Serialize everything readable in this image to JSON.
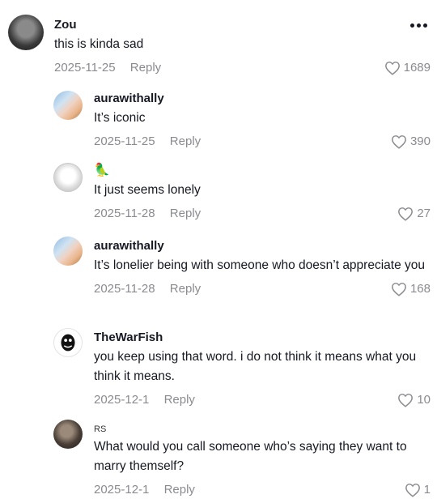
{
  "comments": [
    {
      "username": "Zou",
      "text": "this is kinda sad",
      "date": "2025-11-25",
      "reply": "Reply",
      "likes": "1689"
    },
    {
      "username": "aurawithally",
      "text": "It’s iconic",
      "date": "2025-11-25",
      "reply": "Reply",
      "likes": "390"
    },
    {
      "username": "🦜",
      "text": "It just seems lonely",
      "date": "2025-11-28",
      "reply": "Reply",
      "likes": "27"
    },
    {
      "username": "aurawithally",
      "text": "It’s lonelier being with someone who doesn’t appreciate you",
      "date": "2025-11-28",
      "reply": "Reply",
      "likes": "168"
    },
    {
      "username": "TheWarFish",
      "text": "you keep using that word. i do not think it means what you think it means.",
      "date": "2025-12-1",
      "reply": "Reply",
      "likes": "10"
    },
    {
      "username": "RS",
      "text": "What would you call someone who’s saying they want to marry themself?",
      "date": "2025-12-1",
      "reply": "Reply",
      "likes": "1"
    }
  ],
  "icons": {
    "like": "heart-outline-icon",
    "more": "more-horizontal-icon"
  }
}
